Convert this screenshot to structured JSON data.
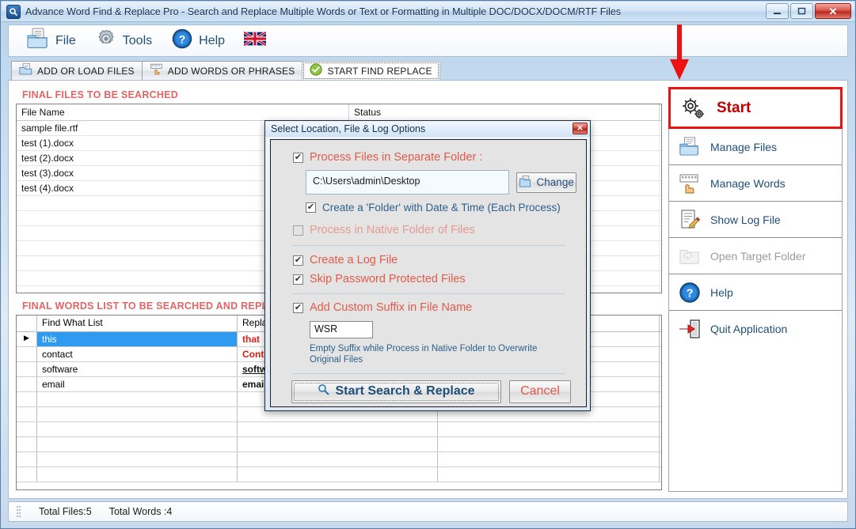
{
  "window": {
    "title": "Advance Word Find & Replace Pro - Search and Replace Multiple Words or Text  or Formatting in Multiple DOC/DOCX/DOCM/RTF Files",
    "minimize_label": "—",
    "maximize_label": "□",
    "close_label": "✕",
    "app_icon": "magnifier-icon"
  },
  "menubar": {
    "items": [
      {
        "label": "File",
        "icon": "file-folder-icon"
      },
      {
        "label": "Tools",
        "icon": "gear-icon"
      },
      {
        "label": "Help",
        "icon": "question-circle-icon"
      },
      {
        "label": "",
        "icon": "uk-flag-icon"
      }
    ]
  },
  "tabs": [
    {
      "label": "ADD OR LOAD FILES",
      "icon": "open-folder-icon",
      "active": false
    },
    {
      "label": "ADD WORDS OR PHRASES",
      "icon": "hand-keyboard-icon",
      "active": false
    },
    {
      "label": "START FIND REPLACE",
      "icon": "green-check-icon",
      "active": true
    }
  ],
  "files_panel": {
    "title": "FINAL FILES TO BE SEARCHED",
    "columns": [
      "File Name",
      "Status"
    ],
    "rows": [
      {
        "file_name": "sample file.rtf",
        "status": ""
      },
      {
        "file_name": "test (1).docx",
        "status": ""
      },
      {
        "file_name": "test (2).docx",
        "status": ""
      },
      {
        "file_name": "test (3).docx",
        "status": ""
      },
      {
        "file_name": "test (4).docx",
        "status": ""
      }
    ]
  },
  "words_panel": {
    "title": "FINAL WORDS LIST TO BE SEARCHED AND REPLACED",
    "columns": [
      "",
      "Find What List",
      "Replace With List",
      ""
    ],
    "rows": [
      {
        "indicator": "▶",
        "find": "this",
        "replace": "that",
        "style": "rep-red",
        "selected": true
      },
      {
        "indicator": "",
        "find": "contact",
        "replace": "Contact",
        "style": "rep-redb",
        "selected": false
      },
      {
        "indicator": "",
        "find": "software",
        "replace": "software",
        "style": "rep-under",
        "selected": false
      },
      {
        "indicator": "",
        "find": "email",
        "replace": "email",
        "style": "rep-plain",
        "selected": false
      }
    ]
  },
  "sidebar": {
    "items": [
      {
        "label": "Start",
        "icon": "gears-icon",
        "state": "highlighted"
      },
      {
        "label": "Manage Files",
        "icon": "files-folder-icon",
        "state": "normal"
      },
      {
        "label": "Manage Words",
        "icon": "hand-keyboard-icon",
        "state": "normal"
      },
      {
        "label": "Show Log File",
        "icon": "log-pencil-icon",
        "state": "normal"
      },
      {
        "label": "Open Target Folder",
        "icon": "folder-icon",
        "state": "disabled"
      },
      {
        "label": "Help",
        "icon": "question-circle-icon",
        "state": "normal"
      },
      {
        "label": "Quit Application",
        "icon": "exit-door-icon",
        "state": "normal"
      }
    ]
  },
  "statusbar": {
    "total_files": "Total Files:5",
    "total_words": "Total Words :4"
  },
  "dialog": {
    "title": "Select Location, File & Log Options",
    "close_label": "✕",
    "separate_folder": {
      "label": "Process Files in Separate Folder :",
      "checked": true,
      "path_value": "C:\\Users\\admin\\Desktop",
      "change_label": "Change",
      "change_icon": "folder-copy-icon"
    },
    "date_time_folder": {
      "label": "Create a 'Folder' with Date & Time (Each Process)",
      "checked": true
    },
    "native_folder": {
      "label": "Process in Native Folder of Files",
      "checked": false
    },
    "create_log": {
      "label": "Create a Log File",
      "checked": true
    },
    "skip_password": {
      "label": "Skip Password Protected Files",
      "checked": true
    },
    "custom_suffix": {
      "label": "Add Custom Suffix in File Name",
      "checked": true,
      "value": "WSR",
      "hint": "Empty Suffix while Process in Native Folder to Overwrite Original Files"
    },
    "start_button": {
      "label": "Start Search & Replace",
      "icon": "search-icon"
    },
    "cancel_button": {
      "label": "Cancel"
    },
    "check_glyph": "✔"
  },
  "colors": {
    "accent_red": "#e06666",
    "highlight_red": "#ee1111",
    "selection_blue": "#2e9bf0",
    "link_blue": "#1f4e79"
  }
}
